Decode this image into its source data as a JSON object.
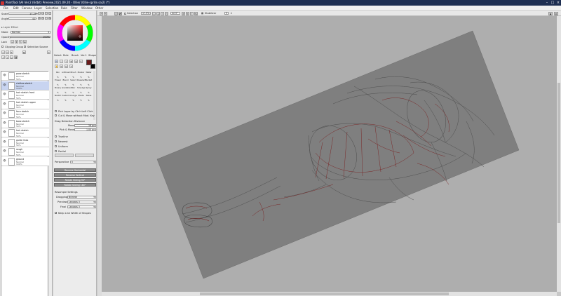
{
  "window": {
    "title": "PaintTool SAI Ver.2 (64bit) Preview.2021.09.20 - Ollie/ (Ollie-sprite.sai2) (*)",
    "controls": [
      "–",
      "□",
      "×"
    ]
  },
  "menu": [
    "File",
    "Edit",
    "Canvas",
    "Layer",
    "Selection",
    "Rule",
    "Filter",
    "Window",
    "Other"
  ],
  "brush_panel": {
    "size_label": "Scale",
    "size_value": "17.29%",
    "angle_label": "Angle",
    "angle_value": "42°",
    "layer_effect": "Layer Effect",
    "mode_label": "Mode",
    "mode_value": "Normal",
    "opacity_label": "Opacity",
    "opacity_value": "100%",
    "lock_label": "Lock",
    "clipping_group": "Clipping Group",
    "selection_source": "Selection Source"
  },
  "layers": [
    {
      "name": "pose sketch",
      "mode": "Normal",
      "opacity": "50%",
      "selected": false
    },
    {
      "name": "clothes sketch",
      "mode": "Normal",
      "opacity": "100%",
      "selected": true
    },
    {
      "name": "hair sketch front",
      "mode": "Normal",
      "opacity": "50%",
      "selected": false
    },
    {
      "name": "hair sketch upper",
      "mode": "Normal",
      "opacity": "50%",
      "selected": false
    },
    {
      "name": "face sketch",
      "mode": "Normal",
      "opacity": "50%",
      "selected": false
    },
    {
      "name": "base sketch",
      "mode": "Normal",
      "opacity": "50%",
      "selected": false
    },
    {
      "name": "hair sketch",
      "mode": "Normal",
      "opacity": "50%",
      "selected": false
    },
    {
      "name": "guide lines",
      "mode": "Normal",
      "opacity": "50%",
      "selected": false
    },
    {
      "name": "rough",
      "mode": "Normal",
      "opacity": "50%",
      "selected": false
    },
    {
      "name": "ground",
      "mode": "Normal",
      "opacity": "100%",
      "selected": false
    }
  ],
  "tool_panel": {
    "tabs": [
      "Select",
      "Rule",
      "Brush",
      "Ver.1",
      "Shape"
    ],
    "tools": [
      {
        "name": "Pen",
        "icon": "pen"
      },
      {
        "name": "AirBrush",
        "icon": "airbrush"
      },
      {
        "name": "Brush",
        "icon": "brush"
      },
      {
        "name": "Marker",
        "icon": "marker"
      },
      {
        "name": "Water",
        "icon": "water"
      },
      {
        "name": "Eraser",
        "icon": "eraser"
      },
      {
        "name": "Blend",
        "icon": "blend"
      },
      {
        "name": "Select",
        "icon": "select"
      },
      {
        "name": "Deselect",
        "icon": "deselect"
      },
      {
        "name": "Bucket",
        "icon": "bucket"
      },
      {
        "name": "Binary",
        "icon": "binary"
      },
      {
        "name": "Gradation",
        "icon": "gradation"
      },
      {
        "name": "Blur",
        "icon": "blur"
      },
      {
        "name": "Smudge",
        "icon": "smudge"
      },
      {
        "name": "Spray",
        "icon": "spray"
      },
      {
        "name": "Sketch",
        "icon": "sketch"
      },
      {
        "name": "Custom",
        "icon": "custom"
      },
      {
        "name": "Grunge",
        "icon": "grunge"
      },
      {
        "name": "Shade",
        "icon": "shade"
      },
      {
        "name": "Noise",
        "icon": "noise"
      }
    ],
    "primary_color": "#6b1a1a",
    "secondary_color": "#000000",
    "pick_layer": "Pick Layer by Ctrl+Left Click",
    "cut_move": "Cut & Move without Mod. Key",
    "drag_detection": "Drag Detection Distance",
    "move_label": "Move",
    "move_value": "16 px",
    "pick_move_label": "Pick & Move",
    "pick_move_value": "1.00 px",
    "options": [
      "Trueline",
      "Nearest",
      "Uniform",
      "Partial"
    ],
    "perspective_label": "Perspective",
    "perspective_value": "5",
    "buttons": [
      "Reverse Horizontal",
      "Reverse Vertical",
      "Rotate Sliding 90°",
      "Rotate Sliding 180°"
    ],
    "resample_settings": "Resample Settings",
    "dragging_label": "Dragging",
    "dragging_value": "Bilinear",
    "preview_label": "Preview",
    "preview_value": "Lanczos 3",
    "final_label": "Final",
    "final_value": "Lanczos 3",
    "keep_line_width": "Keep Line Width of Shapes"
  },
  "canvas_toolbar": {
    "selection_label": "Selection",
    "zoom": "17.9%",
    "angle": "42.5°",
    "stabilizer_label": "Stabilizer",
    "stabilizer_value": "3"
  },
  "colors": {
    "canvas_bg": "#aeaeae",
    "paper": "#7f7f7f",
    "sketch_red": "#7a2020",
    "sketch_gray": "#4a4a4a",
    "title_bar": "#1e2f52",
    "selection": "#c8d4f0"
  }
}
